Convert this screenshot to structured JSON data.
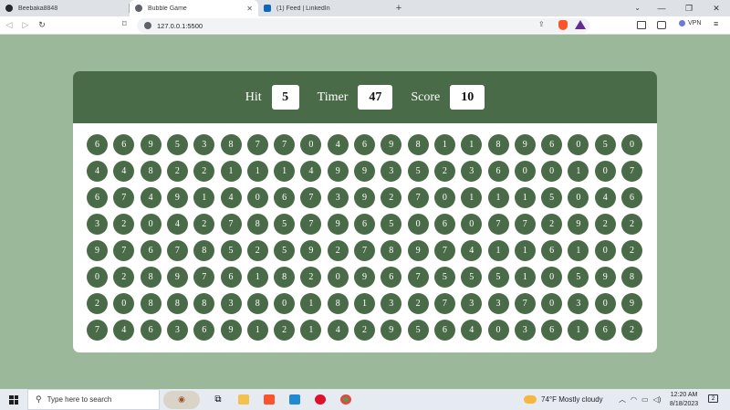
{
  "browser": {
    "tabs": [
      {
        "label": "Beebaka8848",
        "icon": "github-icon",
        "active": false
      },
      {
        "label": "Bubble Game",
        "icon": "globe-icon",
        "active": true
      },
      {
        "label": "(1) Feed | LinkedIn",
        "icon": "linkedin-icon",
        "active": false
      }
    ],
    "new_tab": "+",
    "url": "127.0.0.1:5500",
    "vpn_label": "VPN"
  },
  "game": {
    "hit_label": "Hit",
    "hit_value": "5",
    "timer_label": "Timer",
    "timer_value": "47",
    "score_label": "Score",
    "score_value": "10",
    "accent_color": "#4a6b48",
    "bubbles": [
      [
        "6",
        "6",
        "9",
        "5",
        "3",
        "8",
        "7",
        "7",
        "0",
        "4",
        "6",
        "9",
        "8",
        "1",
        "1",
        "8",
        "9",
        "6",
        "0",
        "5",
        "0"
      ],
      [
        "4",
        "4",
        "8",
        "2",
        "2",
        "1",
        "1",
        "1",
        "4",
        "9",
        "9",
        "3",
        "5",
        "2",
        "3",
        "6",
        "0",
        "0",
        "1",
        "0",
        "7"
      ],
      [
        "6",
        "7",
        "4",
        "9",
        "1",
        "4",
        "0",
        "6",
        "7",
        "3",
        "9",
        "2",
        "7",
        "0",
        "1",
        "1",
        "1",
        "5",
        "0",
        "4",
        "6"
      ],
      [
        "3",
        "2",
        "0",
        "4",
        "2",
        "7",
        "8",
        "5",
        "7",
        "9",
        "6",
        "5",
        "0",
        "6",
        "0",
        "7",
        "7",
        "2",
        "9",
        "2",
        "2"
      ],
      [
        "9",
        "7",
        "6",
        "7",
        "8",
        "5",
        "2",
        "5",
        "9",
        "2",
        "7",
        "8",
        "9",
        "7",
        "4",
        "1",
        "1",
        "6",
        "1",
        "0",
        "2"
      ],
      [
        "0",
        "2",
        "8",
        "9",
        "7",
        "6",
        "1",
        "8",
        "2",
        "0",
        "9",
        "6",
        "7",
        "5",
        "5",
        "5",
        "1",
        "0",
        "5",
        "9",
        "8"
      ],
      [
        "2",
        "0",
        "8",
        "8",
        "8",
        "3",
        "8",
        "0",
        "1",
        "8",
        "1",
        "3",
        "2",
        "7",
        "3",
        "3",
        "7",
        "0",
        "3",
        "0",
        "9"
      ],
      [
        "7",
        "4",
        "6",
        "3",
        "6",
        "9",
        "1",
        "2",
        "1",
        "4",
        "2",
        "9",
        "5",
        "6",
        "4",
        "0",
        "3",
        "6",
        "1",
        "6",
        "2"
      ]
    ]
  },
  "taskbar": {
    "search_placeholder": "Type here to search",
    "weather": "74°F  Mostly cloudy",
    "time": "12:20 AM",
    "date": "8/18/2023",
    "notifications": "2"
  }
}
